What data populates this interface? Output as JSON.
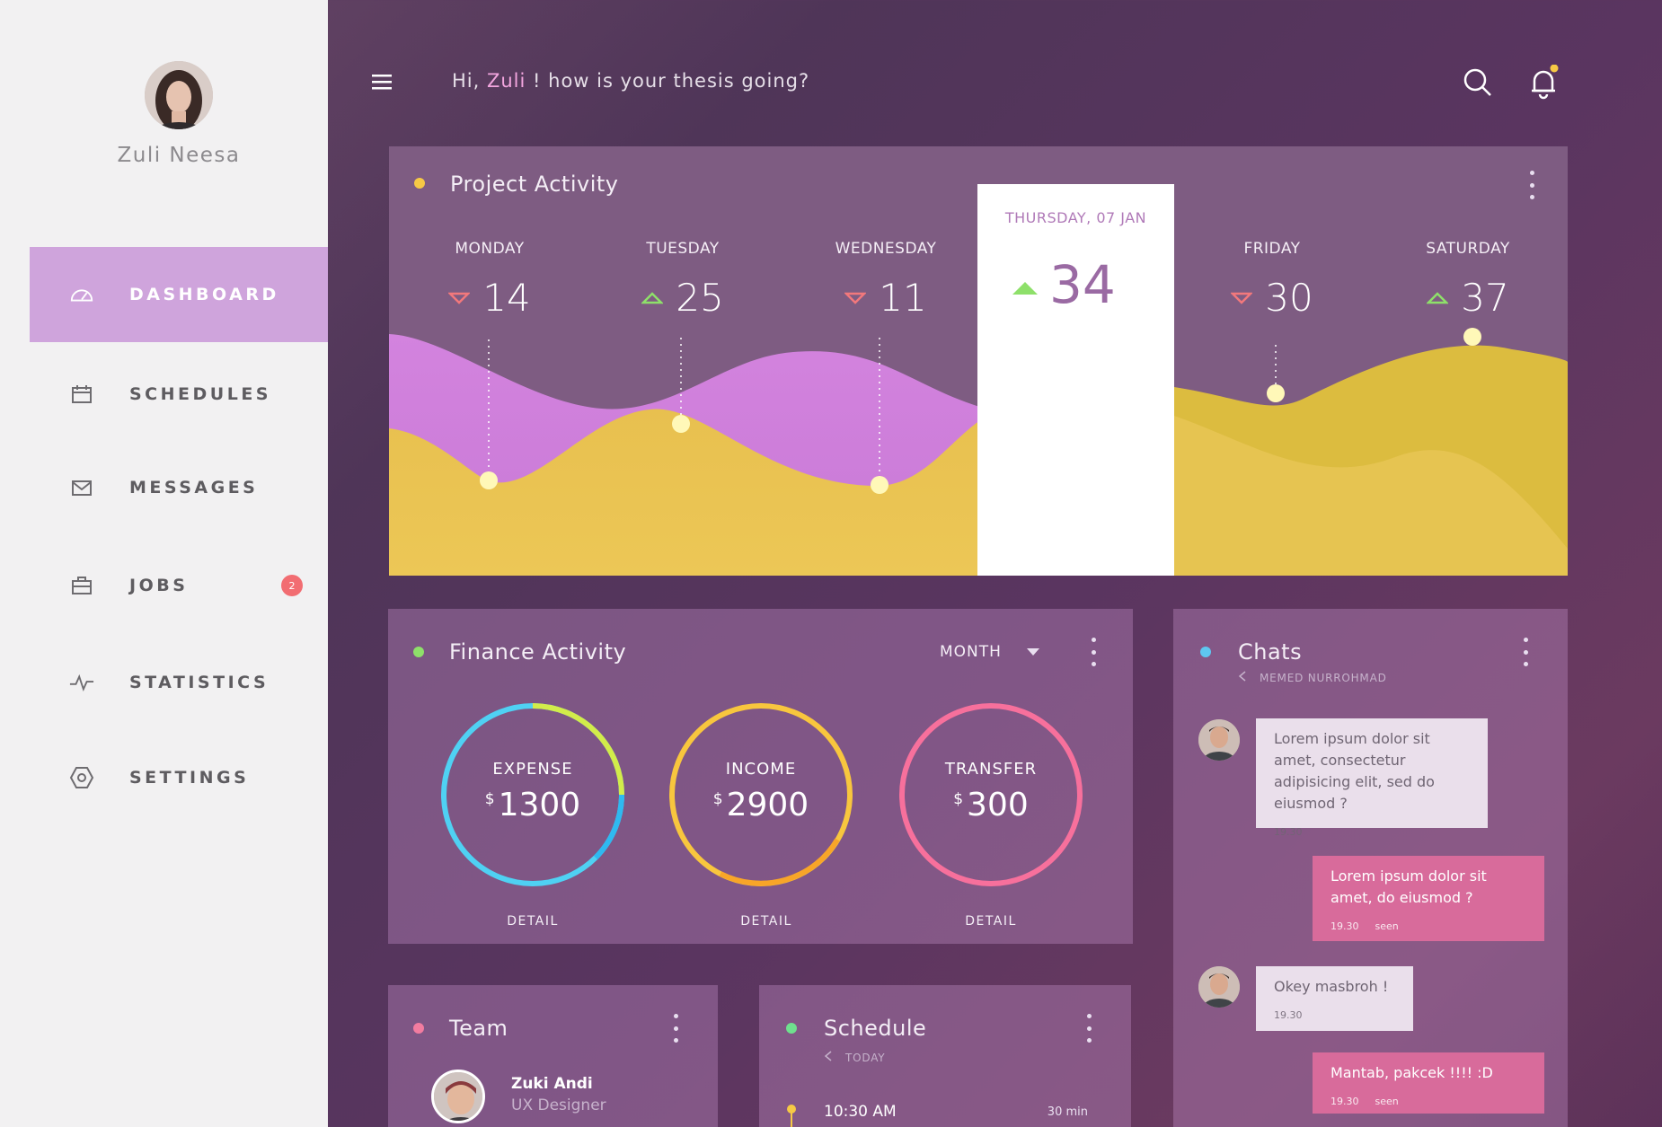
{
  "sidebar": {
    "user_name": "Zuli Neesa",
    "items": [
      {
        "label": "DASHBOARD",
        "icon": "gauge-icon",
        "active": true
      },
      {
        "label": "SCHEDULES",
        "icon": "calendar-icon"
      },
      {
        "label": "MESSAGES",
        "icon": "envelope-icon"
      },
      {
        "label": "JOBS",
        "icon": "briefcase-icon",
        "badge": "2"
      },
      {
        "label": "STATISTICS",
        "icon": "pulse-icon"
      },
      {
        "label": "SETTINGS",
        "icon": "hexagon-icon"
      }
    ]
  },
  "header": {
    "greeting_prefix": "Hi, ",
    "greeting_name": "Zuli",
    "greeting_suffix": " ! how is your thesis going?",
    "notification_dot_color": "#f6c945"
  },
  "project_activity": {
    "title": "Project Activity",
    "dot_color": "#f6c945",
    "days": [
      {
        "name": "MONDAY",
        "value": "14",
        "trend": "down"
      },
      {
        "name": "TUESDAY",
        "value": "25",
        "trend": "up"
      },
      {
        "name": "WEDNESDAY",
        "value": "11",
        "trend": "down"
      },
      {
        "name": "FRIDAY",
        "value": "30",
        "trend": "down"
      },
      {
        "name": "SATURDAY",
        "value": "37",
        "trend": "up"
      }
    ],
    "highlight": {
      "date": "THURSDAY, 07 JAN",
      "value": "34",
      "trend": "up"
    },
    "colors": {
      "purple_area": "#d383de",
      "yellow_area": "#e8c04f",
      "trend_up": "#8ee06a",
      "trend_down": "#f2787c"
    }
  },
  "finance": {
    "title": "Finance Activity",
    "dot_color": "#8ee06a",
    "period": "MONTH",
    "items": [
      {
        "label": "EXPENSE",
        "currency": "$",
        "amount": "1300",
        "detail": "DETAIL"
      },
      {
        "label": "INCOME",
        "currency": "$",
        "amount": "2900",
        "detail": "DETAIL"
      },
      {
        "label": "TRANSFER",
        "currency": "$",
        "amount": "300",
        "detail": "DETAIL"
      }
    ]
  },
  "chats": {
    "title": "Chats",
    "dot_color": "#5ec7f0",
    "contact": "MEMED NURROHMAD",
    "messages": [
      {
        "from": "in",
        "text": "Lorem ipsum dolor sit amet, consectetur adipisicing elit, sed do eiusmod ?",
        "time": "19.30"
      },
      {
        "from": "out",
        "text": "Lorem ipsum dolor sit amet, do eiusmod ?",
        "time": "19.30",
        "status": "seen"
      },
      {
        "from": "in",
        "text": "Okey masbroh !",
        "time": "19.30"
      },
      {
        "from": "out",
        "text": "Mantab, pakcek !!!! :D",
        "time": "19.30",
        "status": "seen"
      }
    ]
  },
  "team": {
    "title": "Team",
    "dot_color": "#f27ca0",
    "member": {
      "name": "Zuki Andi",
      "role": "UX Designer"
    }
  },
  "schedule": {
    "title": "Schedule",
    "dot_color": "#6fe08e",
    "subtitle": "TODAY",
    "entry": {
      "time": "10:30 AM",
      "duration": "30 min"
    }
  }
}
